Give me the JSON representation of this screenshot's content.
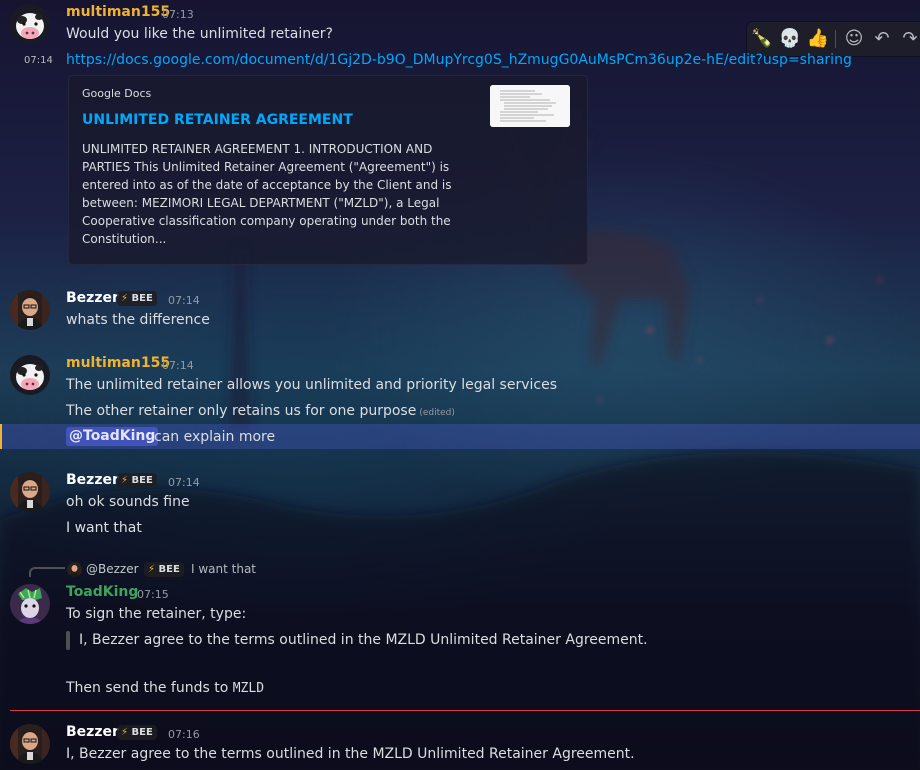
{
  "toolbar": {
    "icons": [
      "person-in-bottle-emoji",
      "skull-emoji",
      "thumbs-up-emoji",
      "add-reaction-icon",
      "reply-icon",
      "forward-icon"
    ],
    "glyphs": [
      "🍾",
      "💀",
      "👍",
      "☺",
      "↶",
      "↷"
    ]
  },
  "messages": [
    {
      "author": "multiman155",
      "time": "07:13",
      "lines": [
        "Would you like the unlimited retainer?"
      ],
      "followup_time": "07:14",
      "link": "https://docs.google.com/document/d/1Gj2D-b9O_DMupYrcg0S_hZmugG0AuMsPCm36up2e-hE/edit?usp=sharing",
      "embed": {
        "provider": "Google Docs",
        "title": "UNLIMITED RETAINER AGREEMENT",
        "description": "UNLIMITED RETAINER AGREEMENT 1. INTRODUCTION AND PARTIES This Unlimited Retainer Agreement (\"Agreement\") is entered into as of the date of acceptance by the Client and is between: MEZIMORI LEGAL DEPARTMENT (\"MZLD\"), a Legal Cooperative classification company operating under both the Constitution..."
      }
    },
    {
      "author": "Bezzer",
      "badge": "BEE",
      "badge_icon": "⚡",
      "time": "07:14",
      "lines": [
        "whats the difference"
      ]
    },
    {
      "author": "multiman155",
      "time": "07:14",
      "lines": [
        "The unlimited retainer allows you unlimited and priority legal services",
        "The other retainer only retains us for one purpose"
      ],
      "edited": "(edited)",
      "mention": "@ToadKing",
      "mention_suffix": "can explain more"
    },
    {
      "author": "Bezzer",
      "badge": "BEE",
      "badge_icon": "⚡",
      "time": "07:14",
      "lines": [
        "oh ok sounds fine",
        "I want that"
      ]
    },
    {
      "reply_to": {
        "author": "@Bezzer",
        "badge": "BEE",
        "badge_icon": "⚡",
        "text": "I want that"
      },
      "author": "ToadKing",
      "time": "07:15",
      "lines": [
        "To sign the retainer, type:"
      ],
      "quote": "I, Bezzer agree to the terms outlined in the MZLD Unlimited Retainer Agreement.",
      "final_prefix": "Then send the funds to",
      "final_code": "MZLD"
    },
    {
      "author": "Bezzer",
      "badge": "BEE",
      "badge_icon": "⚡",
      "time": "07:16",
      "lines": [
        "I, Bezzer agree to the terms outlined in the MZLD Unlimited Retainer Agreement."
      ]
    }
  ],
  "colors": {
    "multiman": "#f0b232",
    "bezzer": "#ffffff",
    "toadking": "#3ba55c",
    "link": "#00a8fc",
    "new_divider": "#d83c3e"
  }
}
